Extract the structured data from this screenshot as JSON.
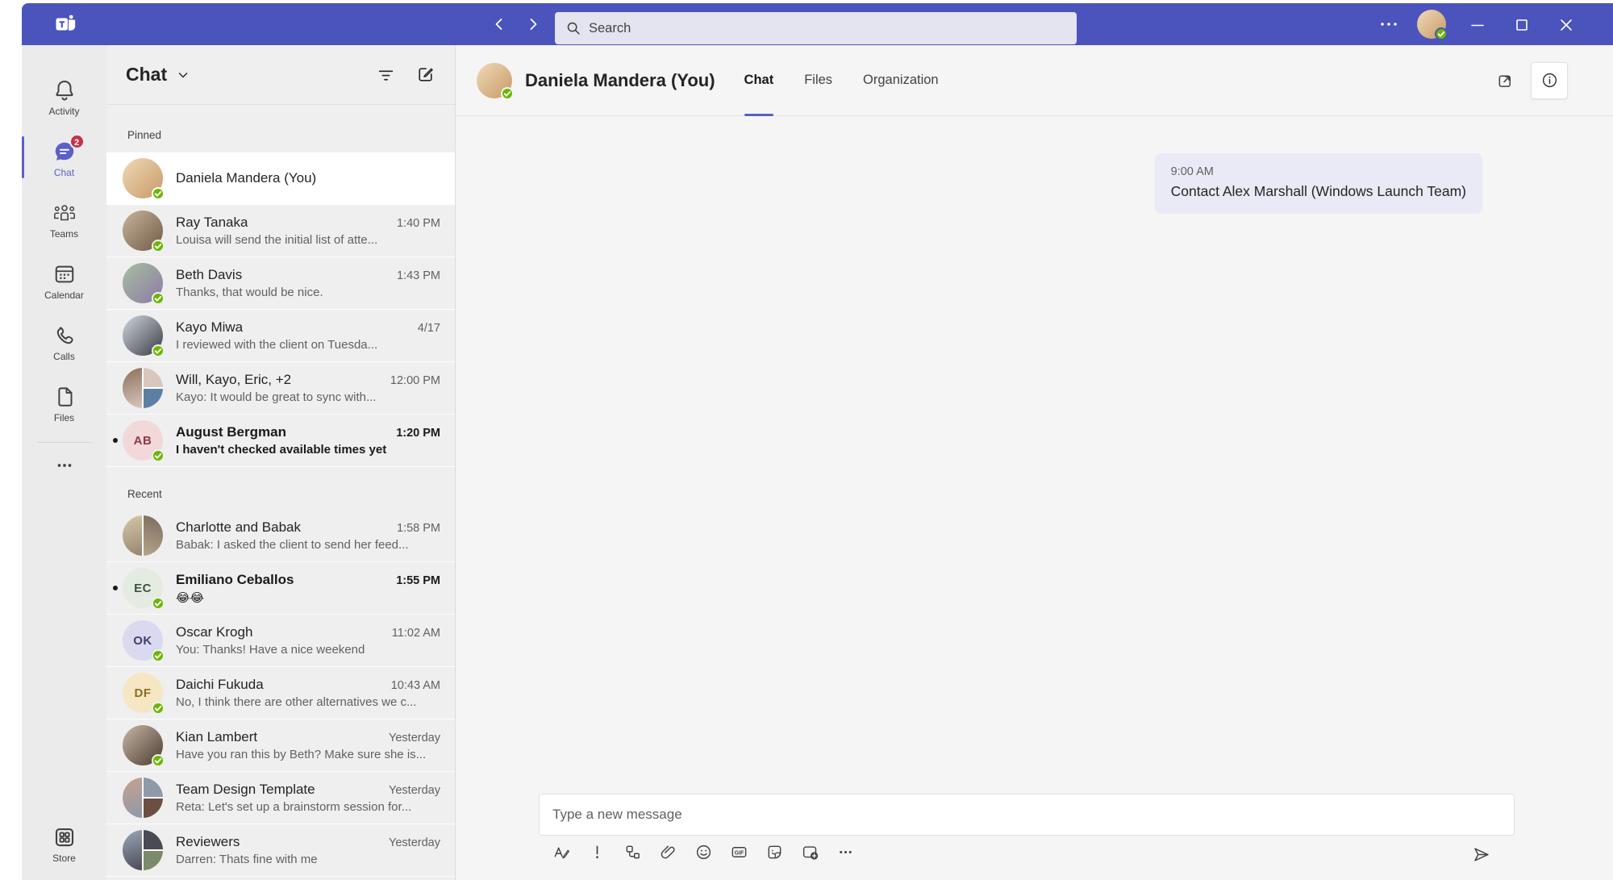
{
  "colors": {
    "topbar": "#4B53BC",
    "accent": "#5B5FC7",
    "badge": "#C4314B",
    "presence": "#6BB700",
    "bubble": "#E9EAF6"
  },
  "titlebar": {
    "search_placeholder": "Search",
    "icons": [
      "teams-logo-icon",
      "back-icon",
      "forward-icon",
      "search-icon",
      "more-icon",
      "minimize-icon",
      "maximize-icon",
      "close-icon"
    ]
  },
  "rail": {
    "items": [
      {
        "label": "Activity",
        "icon": "bell-icon",
        "active": false
      },
      {
        "label": "Chat",
        "icon": "chat-icon",
        "active": true,
        "badge": "2"
      },
      {
        "label": "Teams",
        "icon": "teams-icon",
        "active": false
      },
      {
        "label": "Calendar",
        "icon": "calendar-icon",
        "active": false
      },
      {
        "label": "Calls",
        "icon": "calls-icon",
        "active": false
      },
      {
        "label": "Files",
        "icon": "files-icon",
        "active": false
      }
    ],
    "more_icon": "more-icon",
    "store": {
      "label": "Store",
      "icon": "store-icon"
    }
  },
  "chat_panel": {
    "title": "Chat",
    "header_icons": [
      "chevron-down-icon",
      "filter-icon",
      "new-chat-icon"
    ],
    "sections": [
      {
        "label": "Pinned",
        "rows": [
          {
            "name": "Daniela Mandera (You)",
            "time": "",
            "preview": "",
            "selected": true,
            "unread": false,
            "avatar": {
              "kind": "photo",
              "tones": [
                "#EFD9B8",
                "#C89A66"
              ],
              "presence": true
            }
          },
          {
            "name": "Ray Tanaka",
            "time": "1:40 PM",
            "preview": "Louisa will send the initial list of atte...",
            "selected": false,
            "unread": false,
            "avatar": {
              "kind": "photo",
              "tones": [
                "#C9B49A",
                "#6F5B48"
              ],
              "presence": true
            }
          },
          {
            "name": "Beth Davis",
            "time": "1:43 PM",
            "preview": "Thanks, that would be nice.",
            "selected": false,
            "unread": false,
            "avatar": {
              "kind": "photo",
              "tones": [
                "#A8BFA0",
                "#8B7BA5"
              ],
              "presence": true
            }
          },
          {
            "name": "Kayo Miwa",
            "time": "4/17",
            "preview": "I reviewed with the client on Tuesda...",
            "selected": false,
            "unread": false,
            "avatar": {
              "kind": "photo",
              "tones": [
                "#CFD8DE",
                "#3C3B45"
              ],
              "presence": true
            }
          },
          {
            "name": "Will, Kayo, Eric, +2",
            "time": "12:00 PM",
            "preview": "Kayo: It would be great to sync with...",
            "selected": false,
            "unread": false,
            "avatar": {
              "kind": "group",
              "tones": [
                "#8A6E5A",
                "#D8C7BC",
                "#5D7FA3"
              ],
              "presence": false
            }
          },
          {
            "name": "August Bergman",
            "time": "1:20 PM",
            "preview": "I haven't checked available times yet",
            "selected": false,
            "unread": true,
            "avatar": {
              "kind": "initials",
              "initials": "AB",
              "bg": "#F3D8DA",
              "fg": "#8E3B44",
              "presence": true
            }
          }
        ]
      },
      {
        "label": "Recent",
        "rows": [
          {
            "name": "Charlotte and Babak",
            "time": "1:58 PM",
            "preview": "Babak: I asked the client to send her feed...",
            "selected": false,
            "unread": false,
            "avatar": {
              "kind": "group2",
              "tones": [
                "#D9C9A8",
                "#7A6A5C"
              ],
              "presence": false
            }
          },
          {
            "name": "Emiliano Ceballos",
            "time": "1:55 PM",
            "preview": "😂😂",
            "selected": false,
            "unread": true,
            "avatar": {
              "kind": "initials",
              "initials": "EC",
              "bg": "#E4EBE0",
              "fg": "#3B5441",
              "presence": true
            }
          },
          {
            "name": "Oscar Krogh",
            "time": "11:02 AM",
            "preview": "You: Thanks! Have a nice weekend",
            "selected": false,
            "unread": false,
            "avatar": {
              "kind": "initials",
              "initials": "OK",
              "bg": "#D9D9F0",
              "fg": "#41416E",
              "presence": true
            }
          },
          {
            "name": "Daichi Fukuda",
            "time": "10:43 AM",
            "preview": "No, I think there are other alternatives we c...",
            "selected": false,
            "unread": false,
            "avatar": {
              "kind": "initials",
              "initials": "DF",
              "bg": "#F7E6C4",
              "fg": "#8C6D1F",
              "presence": true
            }
          },
          {
            "name": "Kian Lambert",
            "time": "Yesterday",
            "preview": "Have you ran this by Beth? Make sure she is...",
            "selected": false,
            "unread": false,
            "avatar": {
              "kind": "photo",
              "tones": [
                "#C9B8A8",
                "#4A3A30"
              ],
              "presence": true
            }
          },
          {
            "name": "Team Design Template",
            "time": "Yesterday",
            "preview": "Reta: Let's set up a brainstorm session for...",
            "selected": false,
            "unread": false,
            "avatar": {
              "kind": "group",
              "tones": [
                "#C9A08E",
                "#8D9AA8",
                "#6B4F43"
              ],
              "presence": false
            }
          },
          {
            "name": "Reviewers",
            "time": "Yesterday",
            "preview": "Darren: Thats fine with me",
            "selected": false,
            "unread": false,
            "avatar": {
              "kind": "group",
              "tones": [
                "#9AA8B8",
                "#4A4A55",
                "#7A8A6A"
              ],
              "presence": false
            }
          }
        ]
      }
    ]
  },
  "conversation": {
    "name": "Daniela Mandera (You)",
    "avatar": {
      "kind": "photo",
      "tones": [
        "#EFD9B8",
        "#C89A66"
      ],
      "presence": true
    },
    "tabs": [
      {
        "label": "Chat",
        "active": true
      },
      {
        "label": "Files",
        "active": false
      },
      {
        "label": "Organization",
        "active": false
      }
    ],
    "header_icons": [
      "popout-icon",
      "info-icon"
    ],
    "message": {
      "time": "9:00 AM",
      "text": "Contact Alex Marshall (Windows Launch Team)"
    },
    "compose": {
      "placeholder": "Type a new message",
      "toolbar": [
        "format-icon",
        "priority-icon",
        "loop-icon",
        "attach-icon",
        "emoji-icon",
        "gif-icon",
        "sticker-icon",
        "video-clip-icon",
        "more-icon"
      ],
      "send_icon": "send-icon"
    }
  }
}
